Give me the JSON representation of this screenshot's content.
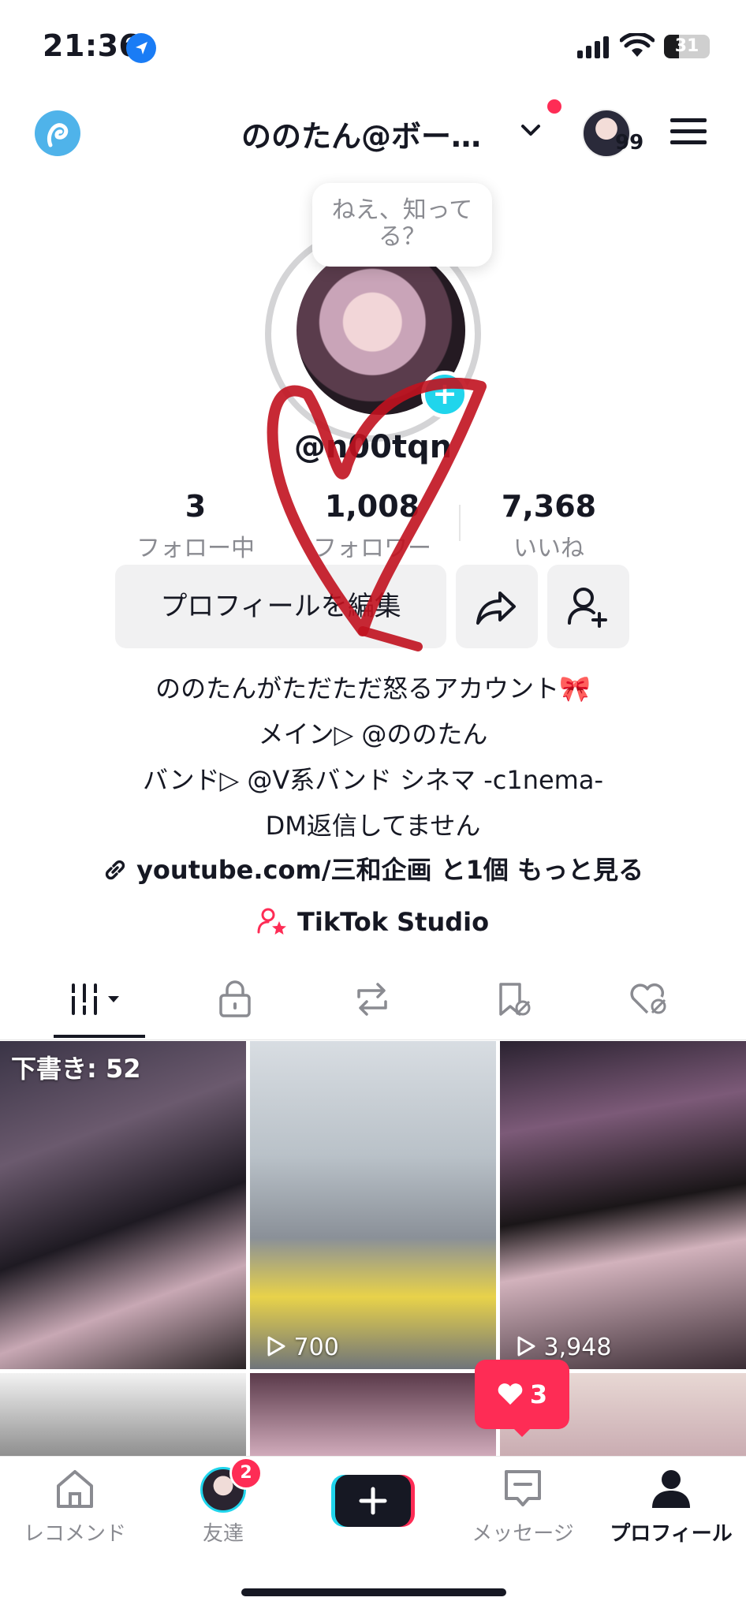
{
  "status": {
    "time": "21:36",
    "battery": "31"
  },
  "header": {
    "title": "ののたん@ボー…",
    "avatar_count": "99"
  },
  "bubble": {
    "line1": "ねえ、知って",
    "line2": "る？"
  },
  "profile": {
    "username": "@n0‍0tqn",
    "stats": [
      {
        "value": "3",
        "label": "フォロー中"
      },
      {
        "value": "1,008",
        "label": "フォロワー"
      },
      {
        "value": "7,368",
        "label": "いいね"
      }
    ],
    "edit_label": "プロフィールを編集",
    "bio": [
      "ののたんがただただ怒るアカウント🎀",
      "メイン▷ @ののたん",
      "バンド▷ @V系バンド シネマ -c1nema-",
      "DM返信してません"
    ],
    "link_text": "youtube.com/三和企画 と1個 もっと見る",
    "studio_label": "TikTok Studio"
  },
  "tabs": [
    "videos",
    "private",
    "reposts",
    "favorites",
    "liked"
  ],
  "grid": {
    "draft_label": "下書き: 52",
    "views": [
      "700",
      "3,948"
    ],
    "like_popup": "3"
  },
  "nav": {
    "items": [
      "レコメンド",
      "友達",
      "",
      "メッセージ",
      "プロフィール"
    ],
    "friends_badge": "2"
  },
  "colors": {
    "accent": "#fe2c55",
    "cyan": "#20d5ec",
    "text": "#161823",
    "muted": "#8a8b91"
  }
}
